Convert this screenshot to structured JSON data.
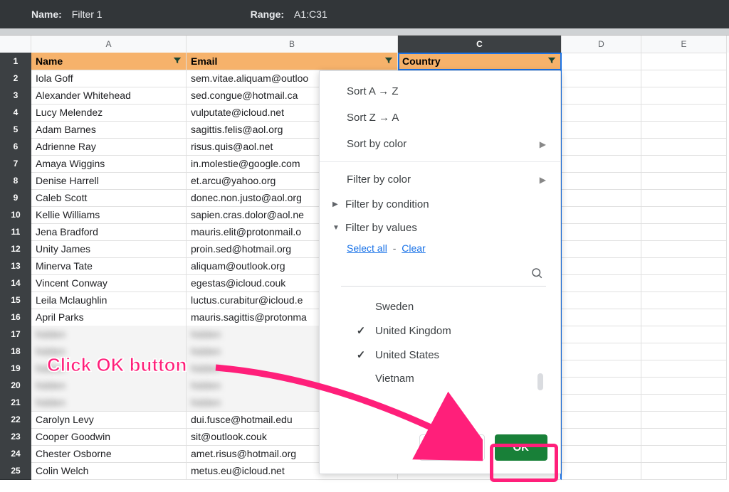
{
  "topbar": {
    "nameLabel": "Name:",
    "nameValue": "Filter 1",
    "rangeLabel": "Range:",
    "rangeValue": "A1:C31"
  },
  "columns": [
    "A",
    "B",
    "C",
    "D",
    "E"
  ],
  "headers": {
    "A": "Name",
    "B": "Email",
    "C": "Country"
  },
  "rows": [
    {
      "n": "1",
      "A": "Name",
      "B": "Email",
      "C": "Country",
      "D": "",
      "E": ""
    },
    {
      "n": "2",
      "A": "Iola Goff",
      "B": "sem.vitae.aliquam@outloo",
      "C": "",
      "D": "",
      "E": ""
    },
    {
      "n": "3",
      "A": "Alexander Whitehead",
      "B": "sed.congue@hotmail.ca",
      "C": "",
      "D": "",
      "E": ""
    },
    {
      "n": "4",
      "A": "Lucy Melendez",
      "B": "vulputate@icloud.net",
      "C": "",
      "D": "",
      "E": ""
    },
    {
      "n": "5",
      "A": "Adam Barnes",
      "B": "sagittis.felis@aol.org",
      "C": "",
      "D": "",
      "E": ""
    },
    {
      "n": "6",
      "A": "Adrienne Ray",
      "B": "risus.quis@aol.net",
      "C": "",
      "D": "",
      "E": ""
    },
    {
      "n": "7",
      "A": "Amaya Wiggins",
      "B": "in.molestie@google.com",
      "C": "",
      "D": "",
      "E": ""
    },
    {
      "n": "8",
      "A": "Denise Harrell",
      "B": "et.arcu@yahoo.org",
      "C": "",
      "D": "",
      "E": ""
    },
    {
      "n": "9",
      "A": "Caleb Scott",
      "B": "donec.non.justo@aol.org",
      "C": "",
      "D": "",
      "E": ""
    },
    {
      "n": "10",
      "A": "Kellie Williams",
      "B": "sapien.cras.dolor@aol.ne",
      "C": "",
      "D": "",
      "E": ""
    },
    {
      "n": "11",
      "A": "Jena Bradford",
      "B": "mauris.elit@protonmail.o",
      "C": "",
      "D": "",
      "E": ""
    },
    {
      "n": "12",
      "A": "Unity James",
      "B": "proin.sed@hotmail.org",
      "C": "",
      "D": "",
      "E": ""
    },
    {
      "n": "13",
      "A": "Minerva Tate",
      "B": "aliquam@outlook.org",
      "C": "",
      "D": "",
      "E": ""
    },
    {
      "n": "14",
      "A": "Vincent Conway",
      "B": "egestas@icloud.couk",
      "C": "",
      "D": "",
      "E": ""
    },
    {
      "n": "15",
      "A": "Leila Mclaughlin",
      "B": "luctus.curabitur@icloud.e",
      "C": "",
      "D": "",
      "E": ""
    },
    {
      "n": "16",
      "A": "April Parks",
      "B": "mauris.sagittis@protonma",
      "C": "",
      "D": "",
      "E": ""
    },
    {
      "n": "17",
      "A": "hidden",
      "B": "hidden",
      "C": "",
      "D": "",
      "E": "",
      "blurred": true
    },
    {
      "n": "18",
      "A": "hidden",
      "B": "hidden",
      "C": "",
      "D": "",
      "E": "",
      "blurred": true
    },
    {
      "n": "19",
      "A": "hidden",
      "B": "hidden",
      "C": "",
      "D": "",
      "E": "",
      "blurred": true
    },
    {
      "n": "20",
      "A": "hidden",
      "B": "hidden",
      "C": "",
      "D": "",
      "E": "",
      "blurred": true
    },
    {
      "n": "21",
      "A": "hidden",
      "B": "hidden",
      "C": "",
      "D": "",
      "E": "",
      "blurred": true
    },
    {
      "n": "22",
      "A": "Carolyn Levy",
      "B": "dui.fusce@hotmail.edu",
      "C": "",
      "D": "",
      "E": ""
    },
    {
      "n": "23",
      "A": "Cooper Goodwin",
      "B": "sit@outlook.couk",
      "C": "",
      "D": "",
      "E": ""
    },
    {
      "n": "24",
      "A": "Chester Osborne",
      "B": "amet.risus@hotmail.org",
      "C": "",
      "D": "",
      "E": ""
    },
    {
      "n": "25",
      "A": "Colin Welch",
      "B": "metus.eu@icloud.net",
      "C": "",
      "D": "",
      "E": ""
    }
  ],
  "popup": {
    "sortAZ": "Sort A → Z",
    "sortZA": "Sort Z → A",
    "sortByColor": "Sort by color",
    "filterByColor": "Filter by color",
    "filterByCondition": "Filter by condition",
    "filterByValues": "Filter by values",
    "selectAll": "Select all",
    "clear": "Clear",
    "searchPlaceholder": "",
    "values": [
      {
        "label": "Sweden",
        "checked": false
      },
      {
        "label": "United Kingdom",
        "checked": true
      },
      {
        "label": "United States",
        "checked": true
      },
      {
        "label": "Vietnam",
        "checked": false
      }
    ],
    "cancel": "Cancel",
    "ok": "OK"
  },
  "annotation": {
    "text": "Click OK button"
  }
}
